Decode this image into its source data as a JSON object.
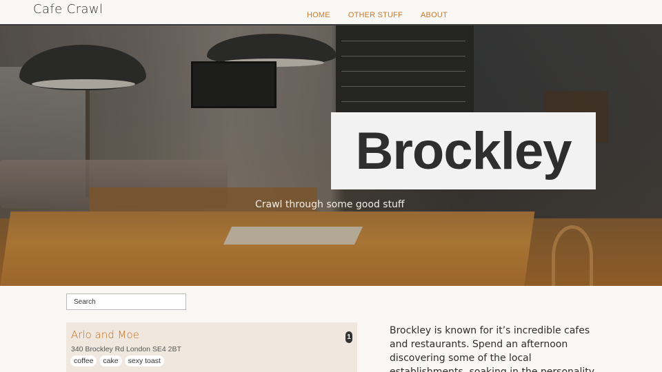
{
  "header": {
    "brand": "Cafe Crawl",
    "nav": [
      {
        "label": "HOME"
      },
      {
        "label": "OTHER STUFF"
      },
      {
        "label": "ABOUT"
      }
    ]
  },
  "hero": {
    "title": "Brockley",
    "tagline": "Crawl through some good stuff"
  },
  "search": {
    "placeholder": "Search"
  },
  "listings": [
    {
      "name": "Arlo and Moe",
      "address": "340 Brockley Rd London SE4 2BT",
      "badge": "1",
      "tags": [
        "coffee",
        "cake",
        "sexy toast"
      ]
    }
  ],
  "intro": {
    "text": "Brockley is known for it’s incredible cafes and restaurants. Spend an afternoon discovering some of the local establishments, soaking in the personality"
  },
  "colors": {
    "accent": "#c8792e",
    "card_bg": "#f0e8df",
    "page_bg": "#faf8f4"
  }
}
